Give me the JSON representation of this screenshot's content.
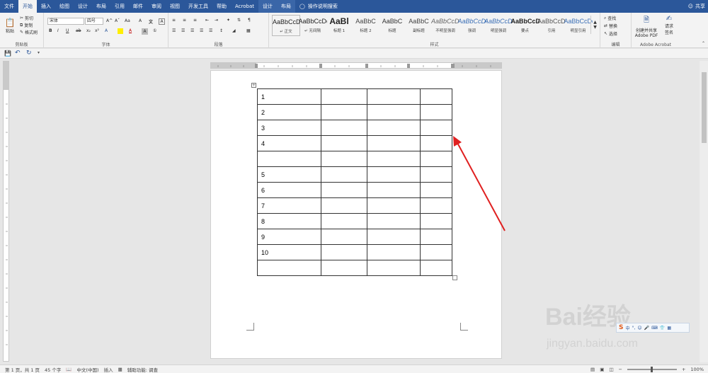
{
  "menu": {
    "tabs": [
      "文件",
      "开始",
      "插入",
      "绘图",
      "设计",
      "布局",
      "引用",
      "邮件",
      "审阅",
      "视图",
      "开发工具",
      "帮助",
      "Acrobat",
      "设计",
      "布局"
    ],
    "active_tab": "开始",
    "search_label": "操作说明搜索",
    "share_label": "共享"
  },
  "ribbon": {
    "clipboard": {
      "paste": "粘贴",
      "cut": "剪切",
      "copy": "复制",
      "format_painter": "格式刷",
      "label": "剪贴板"
    },
    "font": {
      "font_name": "宋体",
      "font_size": "四号",
      "label": "字体",
      "grow": "A^",
      "shrink": "Aˇ",
      "case": "Aa",
      "clear": "A"
    },
    "paragraph": {
      "label": "段落"
    },
    "styles": {
      "label": "样式",
      "items": [
        {
          "sample": "AaBbCcDd",
          "name": "↵ 正文"
        },
        {
          "sample": "AaBbCcDd",
          "name": "↵ 无间隔"
        },
        {
          "sample": "AaBl",
          "name": "标题 1"
        },
        {
          "sample": "AaBbC",
          "name": "标题 2"
        },
        {
          "sample": "AaBbC",
          "name": "标题"
        },
        {
          "sample": "AaBbC",
          "name": "副标题"
        },
        {
          "sample": "AaBbCcDd",
          "name": "不明显强调"
        },
        {
          "sample": "AaBbCcDd",
          "name": "强调"
        },
        {
          "sample": "AaBbCcDd",
          "name": "明显强调"
        },
        {
          "sample": "AaBbCcDd",
          "name": "要点"
        },
        {
          "sample": "AaBbCcDd",
          "name": "引用"
        },
        {
          "sample": "AaBbCcDd",
          "name": "明显引用"
        }
      ]
    },
    "editing": {
      "find": "查找",
      "replace": "替换",
      "select": "选择",
      "label": "编辑"
    },
    "acrobat": {
      "create_share": "创建并共享",
      "adobe_pdf": "Adobe PDF",
      "request": "请求",
      "sign": "签名",
      "label": "Adobe Acrobat"
    }
  },
  "document": {
    "rows": [
      [
        "1",
        "",
        "",
        ""
      ],
      [
        "2",
        "",
        "",
        ""
      ],
      [
        "3",
        "",
        "",
        ""
      ],
      [
        "4",
        "",
        "",
        ""
      ],
      [
        "",
        "",
        "",
        ""
      ],
      [
        "5",
        "",
        "",
        ""
      ],
      [
        "6",
        "",
        "",
        ""
      ],
      [
        "7",
        "",
        "",
        ""
      ],
      [
        "8",
        "",
        "",
        ""
      ],
      [
        "9",
        "",
        "",
        ""
      ],
      [
        "10",
        "",
        "",
        ""
      ],
      [
        "",
        "",
        "",
        ""
      ]
    ]
  },
  "status": {
    "page": "第 1 页，共 1 页",
    "words": "45 个字",
    "language": "中文(中国)",
    "mode": "插入",
    "accessibility": "辅助功能: 调查",
    "zoom": "100%"
  },
  "watermark": {
    "brand": "Bai经验",
    "url": "jingyan.baidu.com"
  },
  "colors": {
    "accent": "#2b579a",
    "arrow": "#e02020"
  }
}
